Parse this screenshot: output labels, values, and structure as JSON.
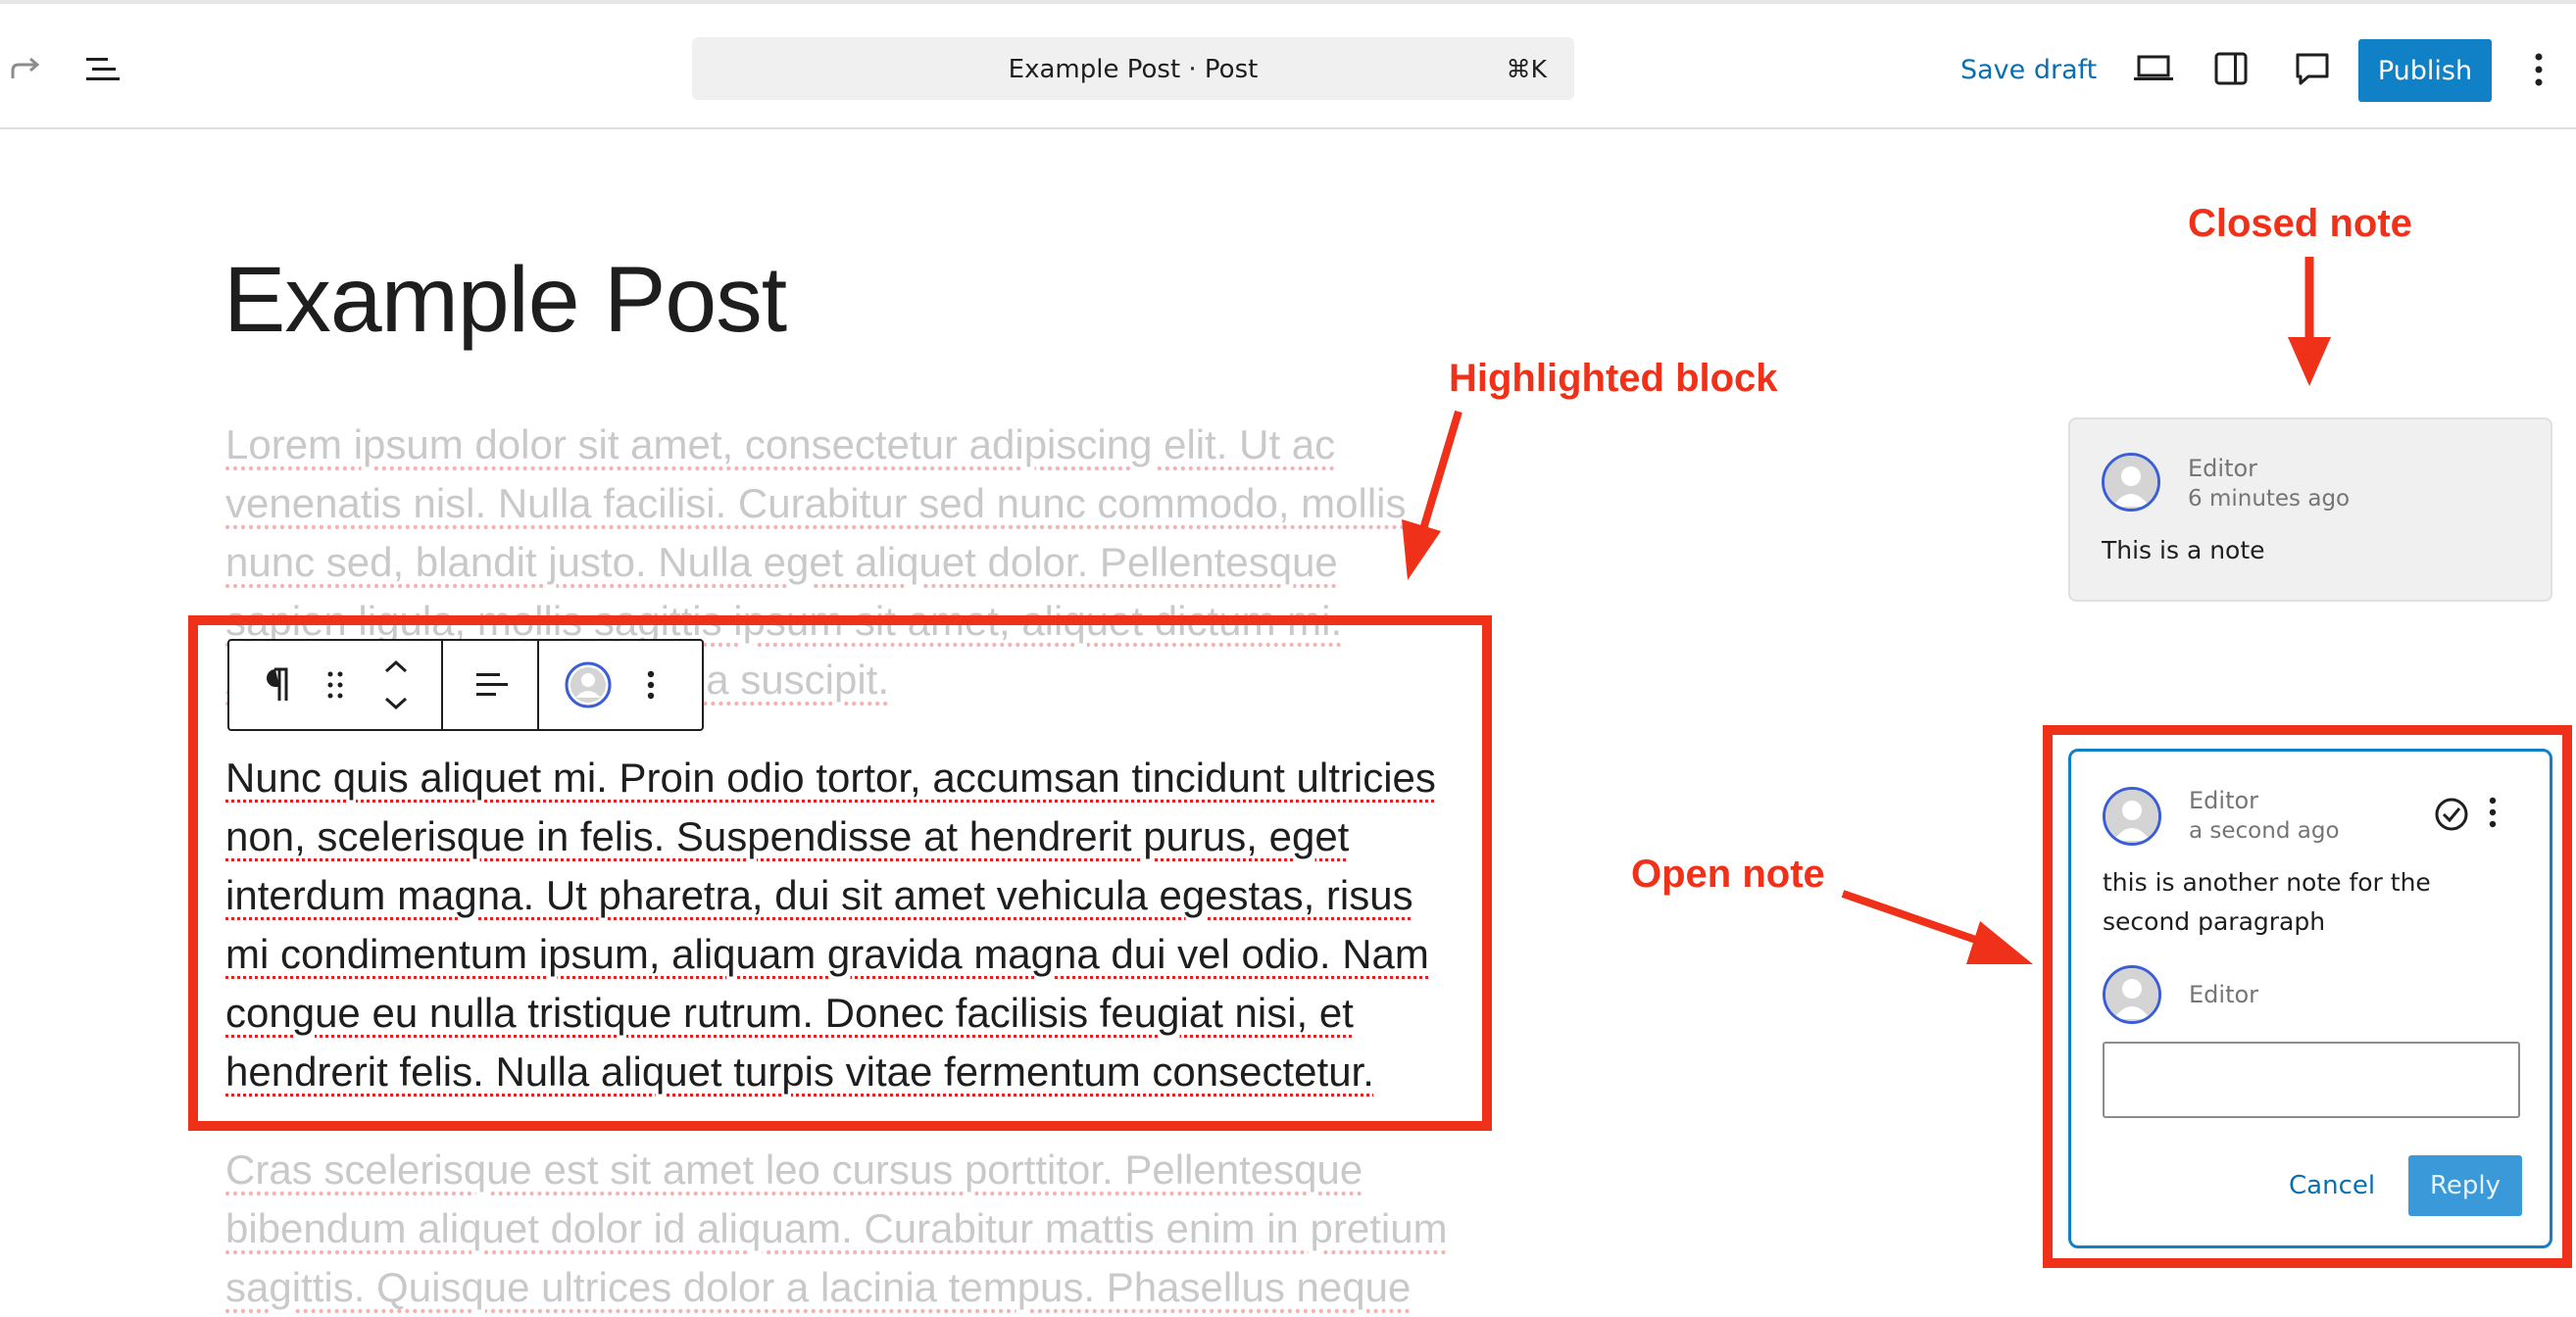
{
  "topbar": {
    "command_title": "Example Post · Post",
    "command_shortcut": "⌘K",
    "save_draft_label": "Save draft",
    "publish_label": "Publish"
  },
  "post": {
    "title": "Example Post",
    "paragraph1": "Lorem ipsum dolor sit amet, consectetur adipiscing elit. Ut ac\nvenenatis nisl. Nulla facilisi. Curabitur sed nunc commodo, mollis\nnunc sed, blandit justo. Nulla eget aliquet dolor. Pellentesque\nsapien ligula, mollis sagittis ipsum sit amet, aliquet dictum mi.\nAliquam erat volutpat. Nulla suscipit.",
    "paragraph2": "Nunc quis aliquet mi. Proin odio tortor, accumsan tincidunt ultricies\nnon, scelerisque in felis. Suspendisse at hendrerit purus, eget\ninterdum magna. Ut pharetra, dui sit amet vehicula egestas, risus\nmi condimentum ipsum, aliquam gravida magna dui vel odio. Nam\ncongue eu nulla tristique rutrum. Donec facilisis feugiat nisi, et\nhendrerit felis. Nulla aliquet turpis vitae fermentum consectetur.",
    "paragraph3": "Cras scelerisque est sit amet leo cursus porttitor. Pellentesque\nbibendum aliquet dolor id aliquam. Curabitur mattis enim in pretium\nsagittis. Quisque ultrices dolor a lacinia tempus. Phasellus neque"
  },
  "annotations": {
    "closed_note": "Closed note",
    "highlighted_block": "Highlighted block",
    "open_note": "Open note"
  },
  "notes": {
    "closed": {
      "author": "Editor",
      "time": "6 minutes ago",
      "body": "This is a note"
    },
    "open": {
      "author": "Editor",
      "time": "a second ago",
      "body": "this is another note for the second paragraph",
      "reply_author": "Editor",
      "cancel_label": "Cancel",
      "reply_label": "Reply"
    }
  },
  "colors": {
    "accent": "#1081c6",
    "annotation_red": "#f0311a"
  }
}
